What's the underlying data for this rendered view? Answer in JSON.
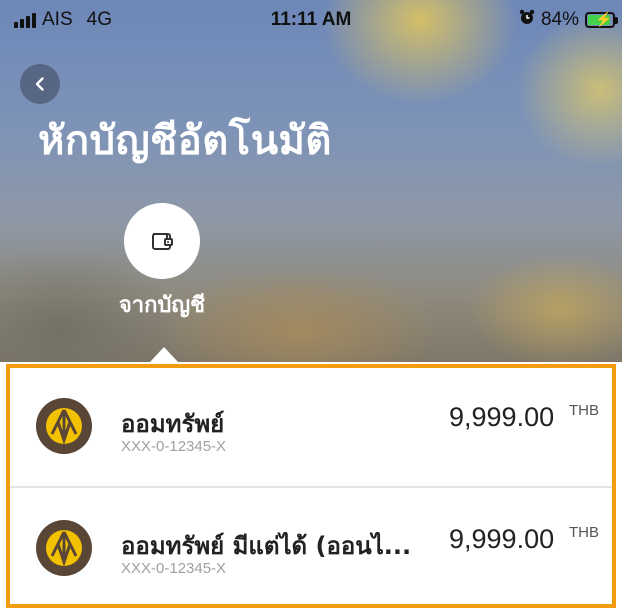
{
  "status_bar": {
    "carrier": "AIS",
    "network": "4G",
    "time": "11:11 AM",
    "battery": "84%"
  },
  "header": {
    "title": "หักบัญชีอัตโนมัติ",
    "back_icon": "chevron-left-icon",
    "source": {
      "label": "จากบัญชี",
      "icon": "wallet-icon"
    }
  },
  "accounts": [
    {
      "name": "ออมทรัพย์",
      "number": "XXX-0-12345-X",
      "amount": "9,999.00",
      "currency": "THB"
    },
    {
      "name": "ออมทรัพย์ มีแต่ได้ (ออนไ...",
      "number": "XXX-0-12345-X",
      "amount": "9,999.00",
      "currency": "THB"
    }
  ],
  "colors": {
    "highlight_border": "#f39c12",
    "bank_logo_bg": "#5a4636",
    "bank_logo_fg": "#f2c200",
    "battery_fill": "#43d04a"
  }
}
